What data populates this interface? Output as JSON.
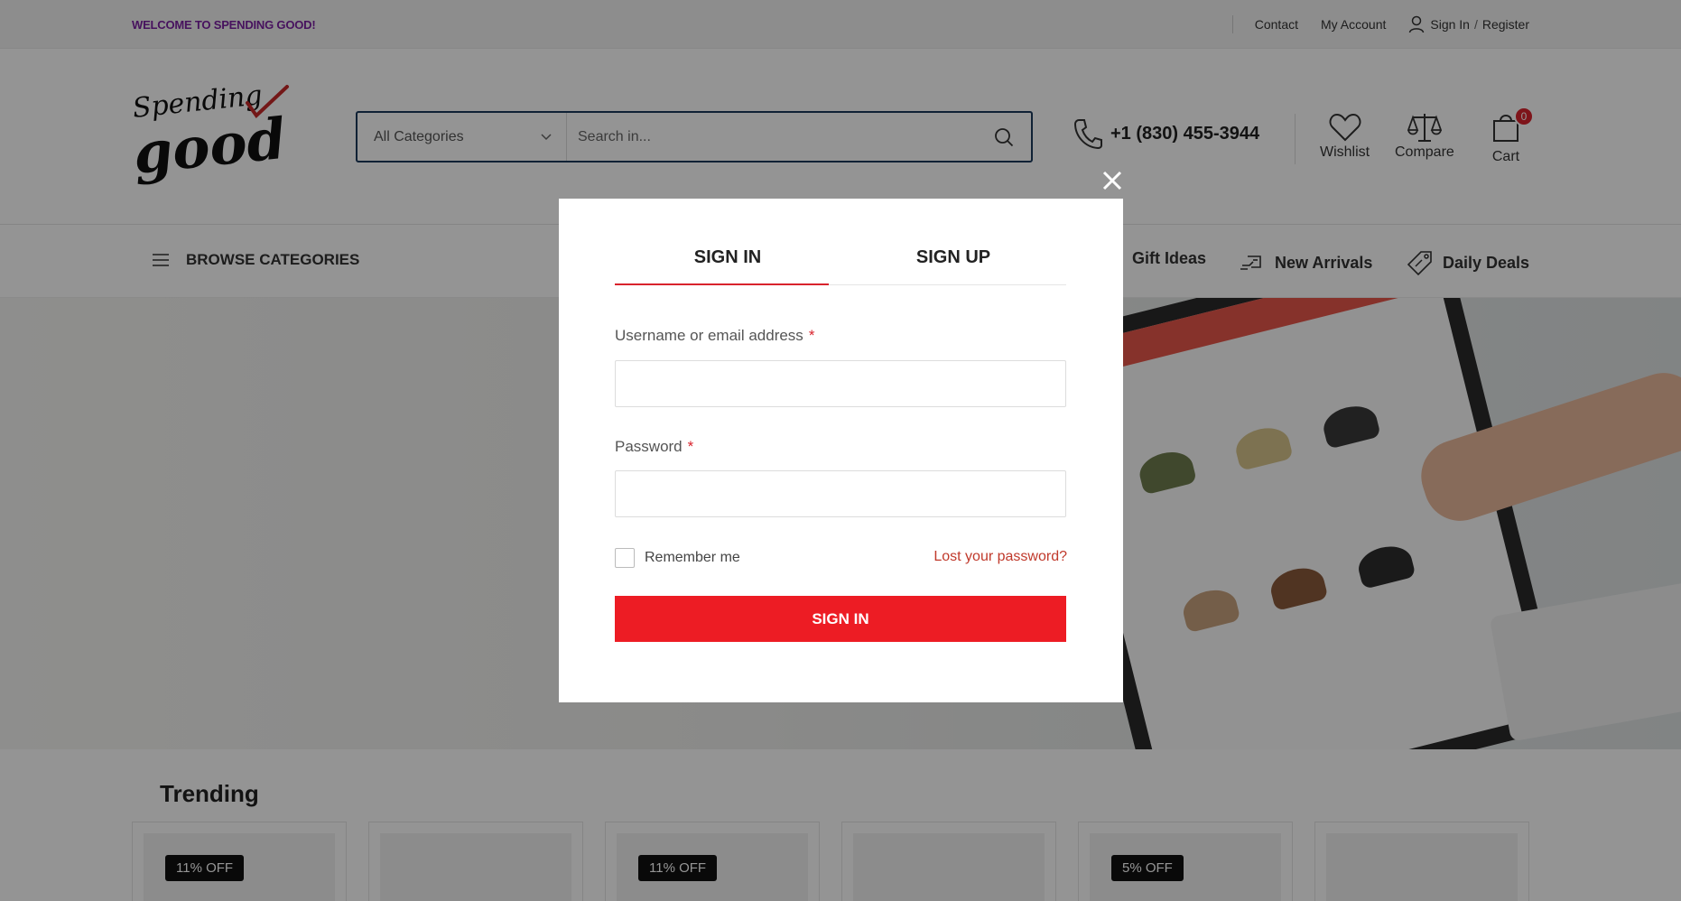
{
  "topbar": {
    "welcome": "WELCOME TO SPENDING GOOD!",
    "contact": "Contact",
    "my_account": "My Account",
    "sign_in": "Sign In",
    "slash": "/",
    "register": "Register"
  },
  "header": {
    "logo_icon": "spending-good-logo",
    "search": {
      "category": "All Categories",
      "placeholder": "Search in..."
    },
    "phone": "+1 (830) 455-3944",
    "wishlist": "Wishlist",
    "compare": "Compare",
    "cart": "Cart",
    "cart_count": "0"
  },
  "nav": {
    "browse": "BROWSE CATEGORIES",
    "gift_ideas": "Gift Ideas",
    "new_arrivals": "New Arrivals",
    "daily_deals": "Daily Deals"
  },
  "trending": {
    "title": "Trending",
    "badges": [
      "11% OFF",
      "11% OFF",
      "5% OFF"
    ]
  },
  "modal": {
    "tab_signin": "SIGN IN",
    "tab_signup": "SIGN UP",
    "username_label": "Username or email address",
    "password_label": "Password",
    "required_mark": "*",
    "remember": "Remember me",
    "lost_password": "Lost your password?",
    "submit": "SIGN IN"
  },
  "colors": {
    "accent_red": "#ed1c24",
    "welcome_purple": "#7b1fa2",
    "search_border": "#1b3a5c"
  }
}
